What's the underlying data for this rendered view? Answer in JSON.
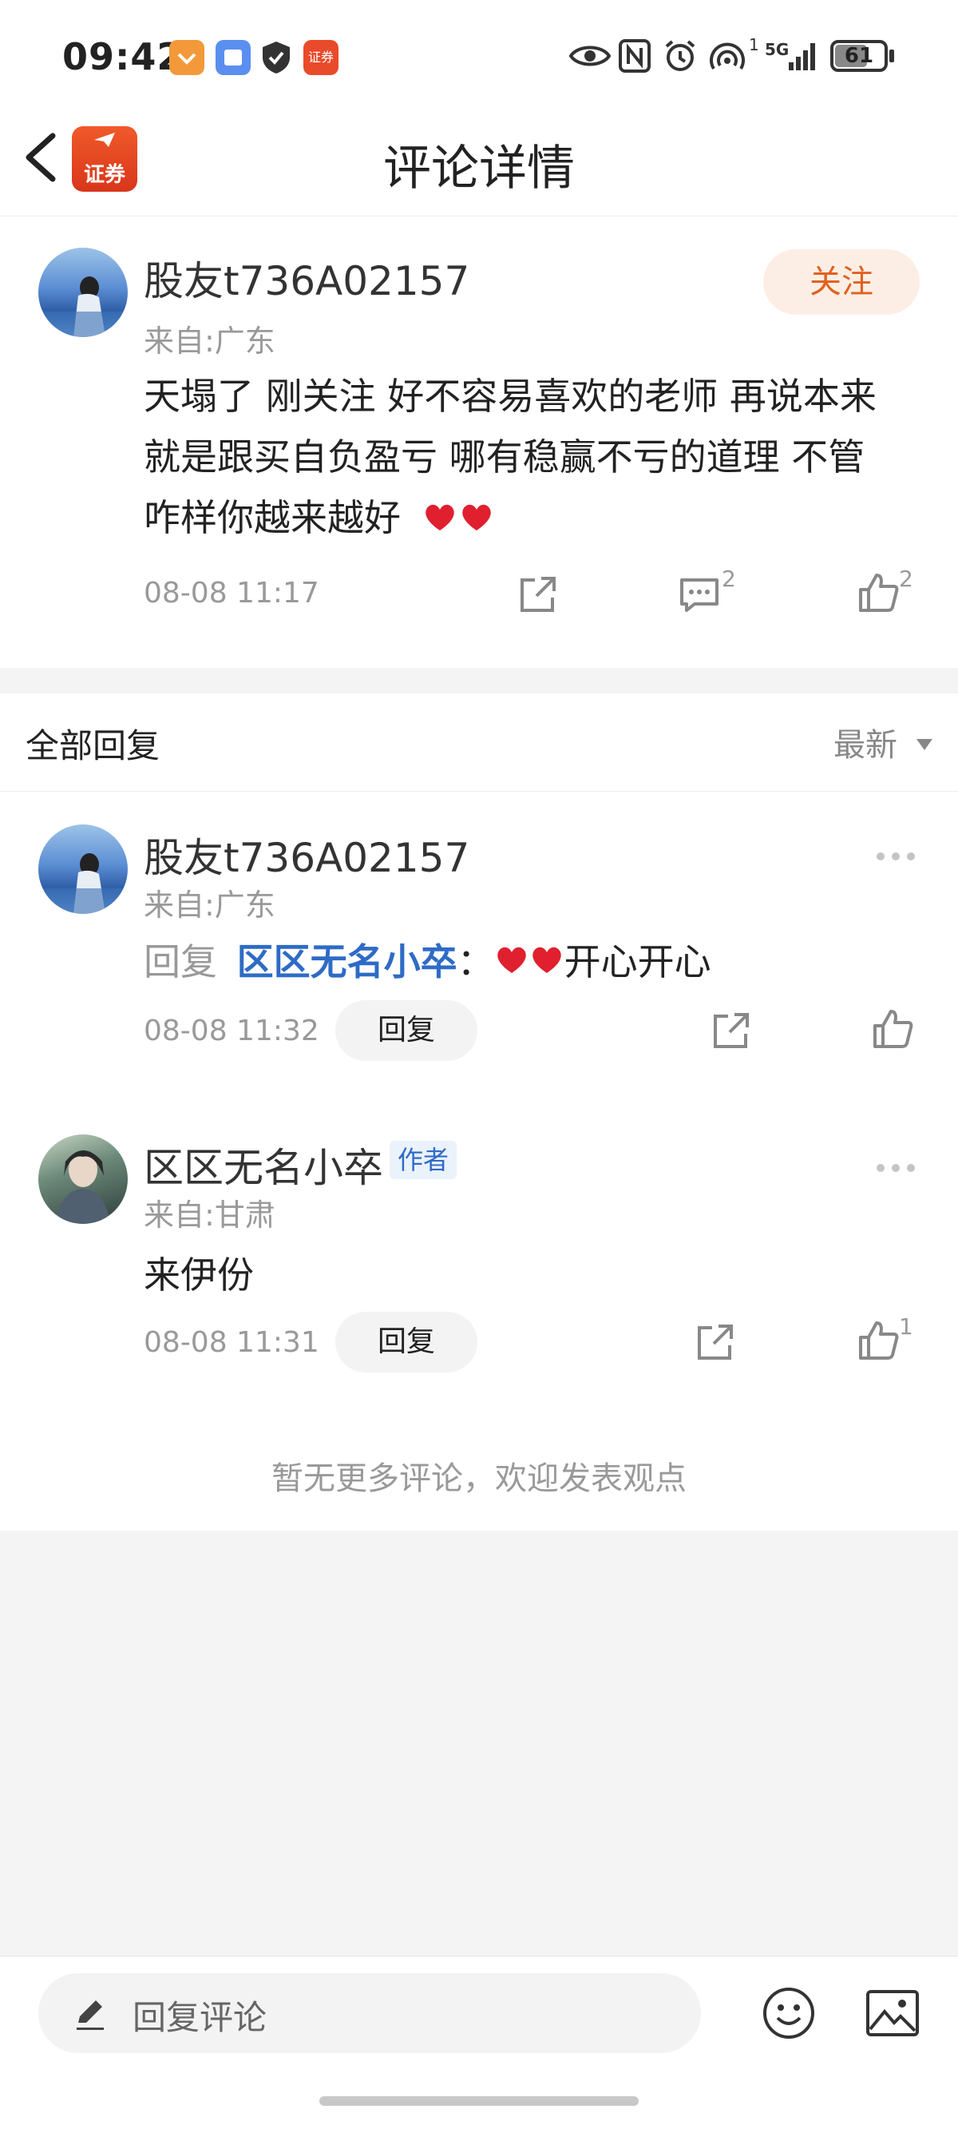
{
  "status_bar": {
    "time": "09:42",
    "signal_sup": "1",
    "network": "5G",
    "battery": "61"
  },
  "header": {
    "title": "评论详情",
    "app_badge": "证券"
  },
  "main_comment": {
    "username": "股友t736A02157",
    "location": "来自:广东",
    "follow_label": "关注",
    "text_line1": "天塌了 刚关注 好不容易喜欢的老师 再说本来",
    "text_line2": "就是跟买自负盈亏 哪有稳赢不亏的道理 不管",
    "text_line3": "咋样你越来越好",
    "time": "08-08 11:17",
    "comment_count": "2",
    "like_count": "2"
  },
  "replies_section": {
    "title": "全部回复",
    "sort_label": "最新"
  },
  "replies": [
    {
      "username": "股友t736A02157",
      "location": "来自:广东",
      "prefix": "回复",
      "mention": "区区无名小卒",
      "separator": "：",
      "text": "开心开心",
      "time": "08-08 11:32",
      "reply_label": "回复",
      "like_count": ""
    },
    {
      "username": "区区无名小卒",
      "author_badge": "作者",
      "location": "来自:甘肃",
      "text": "来伊份",
      "time": "08-08 11:31",
      "reply_label": "回复",
      "like_count": "1"
    }
  ],
  "end_note": "暂无更多评论，欢迎发表观点",
  "bottom_bar": {
    "placeholder": "回复评论"
  },
  "colors": {
    "accent_link": "#2e6bc6",
    "follow_bg": "#fdeee5",
    "follow_text": "#e0621f",
    "heart": "#e0202e"
  }
}
